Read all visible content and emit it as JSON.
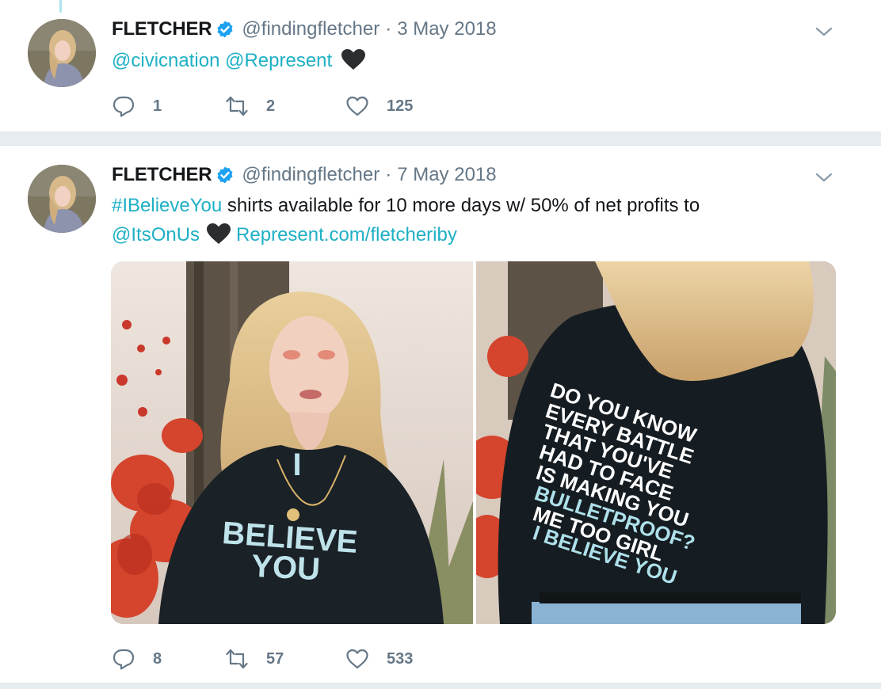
{
  "tweets": [
    {
      "name": "FLETCHER",
      "handle": "@findingfletcher",
      "separator": "·",
      "date": "3 May 2018",
      "text_parts": [
        "@civicnation",
        "@Represent"
      ],
      "reply_count": "1",
      "retweet_count": "2",
      "like_count": "125"
    },
    {
      "name": "FLETCHER",
      "handle": "@findingfletcher",
      "separator": "·",
      "date": "7 May 2018",
      "hashtag": "#IBelieveYou",
      "text_line1_rest": " shirts available for 10 more days w/ 50% of net profits to",
      "mention": "@ItsOnUs",
      "url": "Represent.com/fletcheriby",
      "reply_count": "8",
      "retweet_count": "57",
      "like_count": "533",
      "photo1_shirt_text": [
        "I",
        "BELIEVE",
        "YOU"
      ],
      "photo2_shirt_text": [
        "DO YOU KNOW",
        "EVERY BATTLE",
        "THAT YOU'VE",
        "HAD TO FACE",
        "IS MAKING YOU",
        "BULLETPROOF?",
        "ME TOO GIRL",
        "I BELIEVE YOU"
      ]
    }
  ],
  "colors": {
    "link": "#1da1f2",
    "teal_link": "#1eb0c4",
    "muted": "#657786",
    "verified": "#1da1f2"
  },
  "icons": [
    "verified-badge-icon",
    "chevron-down-icon",
    "reply-icon",
    "retweet-icon",
    "like-icon",
    "black-heart-emoji-icon"
  ]
}
